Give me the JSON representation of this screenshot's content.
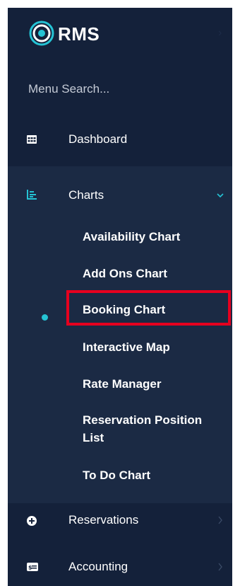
{
  "brand": {
    "logo_text": "RMS",
    "accent_color": "#25c3d4",
    "sidebar_bg": "#14213a"
  },
  "search": {
    "placeholder": "Menu Search..."
  },
  "nav": {
    "dashboard": {
      "label": "Dashboard",
      "icon": "grid-table-icon"
    },
    "charts": {
      "label": "Charts",
      "icon": "chart-icon",
      "expanded": true,
      "items": [
        {
          "label": "Availability Chart"
        },
        {
          "label": "Add Ons Chart"
        },
        {
          "label": "Booking Chart",
          "active": true,
          "highlighted": true
        },
        {
          "label": "Interactive Map"
        },
        {
          "label": "Rate Manager"
        },
        {
          "label": "Reservation Position List"
        },
        {
          "label": "To Do Chart"
        }
      ]
    },
    "reservations": {
      "label": "Reservations",
      "icon": "plus-circle-icon"
    },
    "accounting": {
      "label": "Accounting",
      "icon": "money-icon"
    }
  },
  "annotation": {
    "highlight_color": "#e6001f"
  }
}
